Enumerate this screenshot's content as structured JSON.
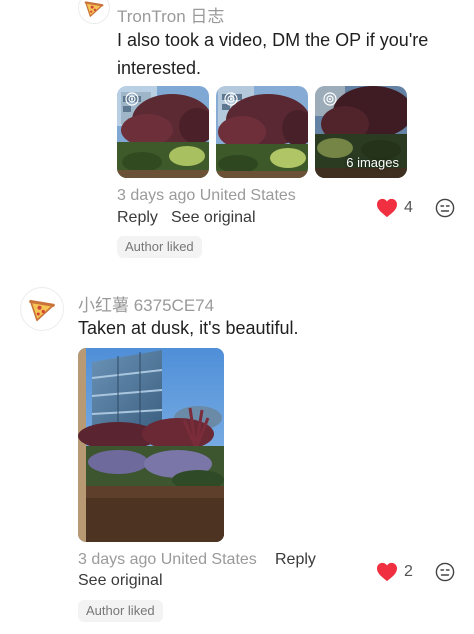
{
  "comment1": {
    "username": "TronTron 日志",
    "text": "I also took a video, DM the OP if you're interested.",
    "more_images": "6 images",
    "time": "3 days ago",
    "location": "United States",
    "reply_label": "Reply",
    "see_original_label": "See original",
    "likes": "4",
    "author_liked": "Author liked"
  },
  "comment2": {
    "username": "小红薯 6375CE74",
    "text": "Taken at dusk, it's beautiful.",
    "time": "3 days ago",
    "location": "United States",
    "reply_label": "Reply",
    "see_original_label": "See original",
    "likes": "2",
    "author_liked": "Author liked"
  },
  "colors": {
    "heart": "#f03040",
    "meta": "#9a9a9a"
  }
}
